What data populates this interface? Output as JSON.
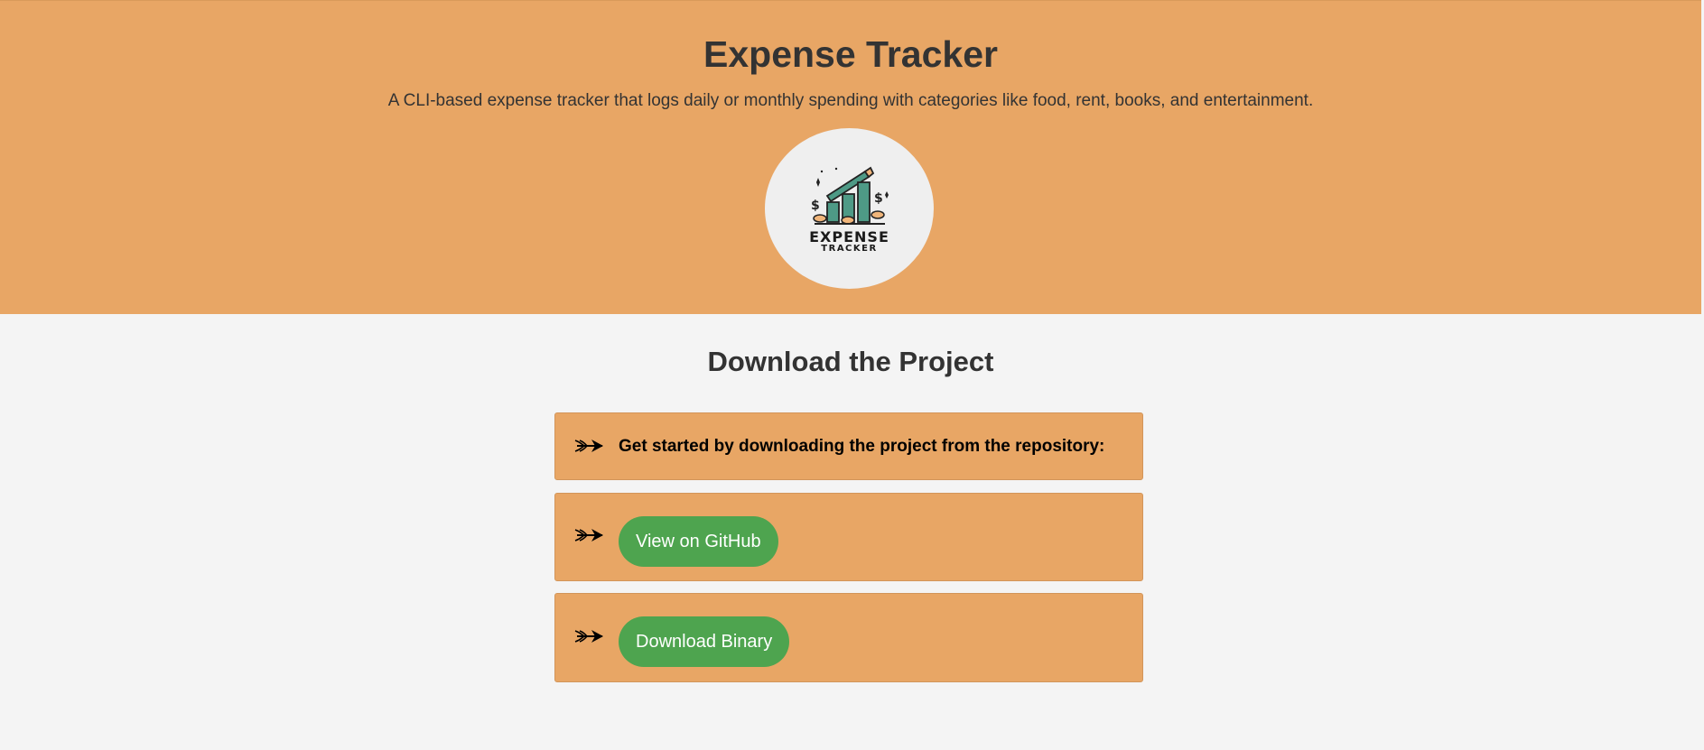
{
  "header": {
    "title": "Expense Tracker",
    "subtitle": "A CLI-based expense tracker that logs daily or monthly spending with categories like food, rent, books, and entertainment.",
    "logo": {
      "line1": "EXPENSE",
      "line2": "TRACKER"
    }
  },
  "download": {
    "title": "Download the Project",
    "intro_text": "Get started by downloading the project from the repository:",
    "github_button": "View on GitHub",
    "binary_button": "Download Binary",
    "bullet_icon": "arrow-icon"
  },
  "colors": {
    "header_bg": "#e8a665",
    "page_bg": "#f4f4f4",
    "button": "#4ea44f"
  }
}
